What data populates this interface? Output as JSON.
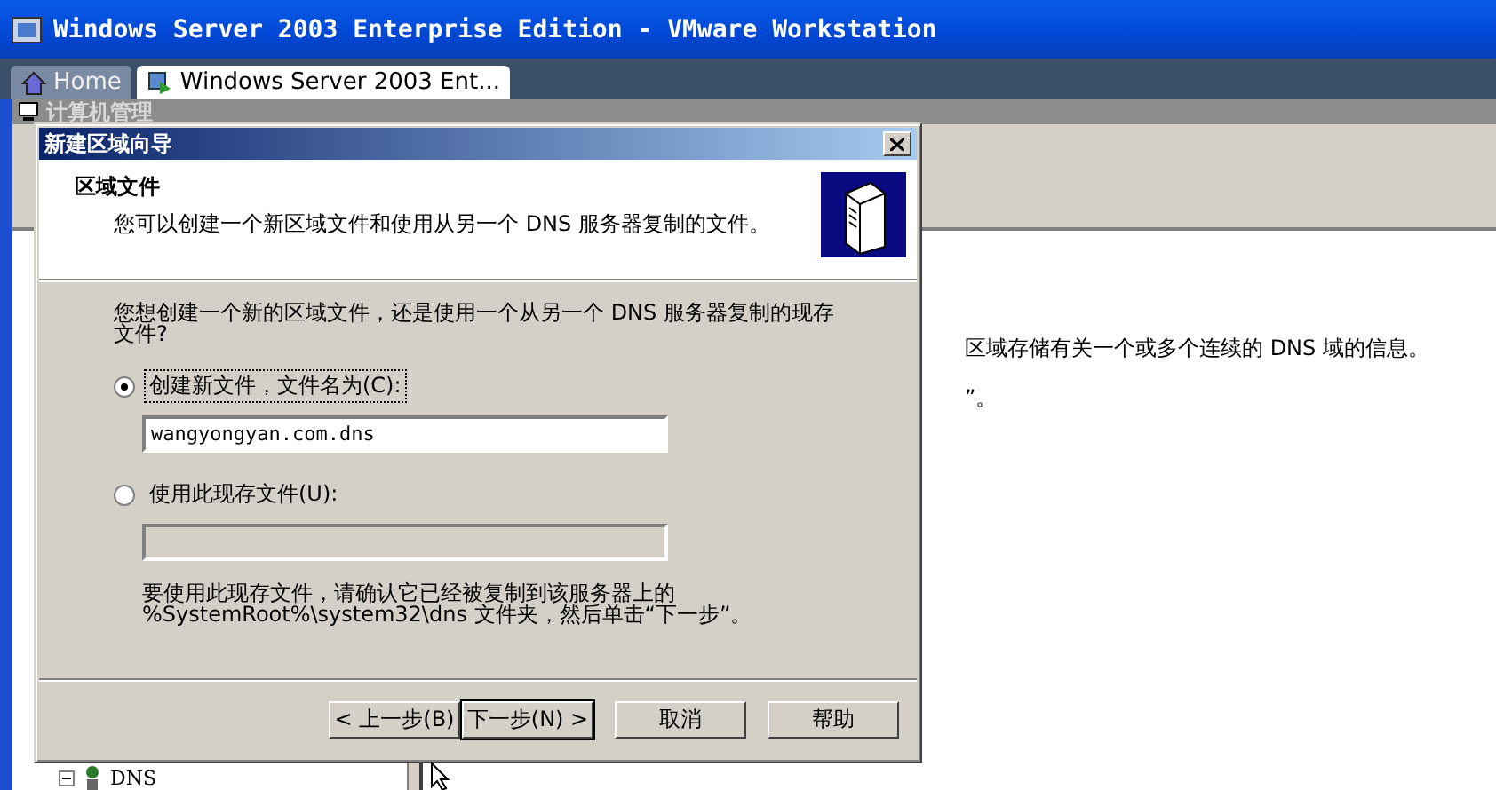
{
  "window": {
    "title": "Windows Server 2003 Enterprise Edition - VMware Workstation"
  },
  "tabs": [
    {
      "label": "Home",
      "selected": false
    },
    {
      "label": "Windows Server 2003 Ent...",
      "selected": true
    }
  ],
  "console": {
    "title": "计算机管理",
    "tree": [
      {
        "label": "DNS"
      }
    ],
    "details": [
      "区域存储有关一个或多个连续的 DNS 域的信息。",
      "”。"
    ]
  },
  "dialog": {
    "title": "新建区域向导",
    "heading": "区域文件",
    "subtitle": "您可以创建一个新区域文件和使用从另一个 DNS 服务器复制的文件。",
    "question": "您想创建一个新的区域文件，还是使用一个从另一个 DNS 服务器复制的现存文件?",
    "options": [
      {
        "label": "创建新文件，文件名为(C):",
        "selected": true,
        "value": "wangyongyan.com.dns",
        "disabled": false
      },
      {
        "label": "使用此现存文件(U):",
        "selected": false,
        "disabled": true
      }
    ],
    "note": "要使用此现存文件，请确认它已经被复制到该服务器上的\n%SystemRoot%\\system32\\dns 文件夹，然后单击“下一步”。",
    "buttons": [
      {
        "label": "< 上一步(B)",
        "default": false
      },
      {
        "label": "下一步(N) >",
        "default": true
      },
      {
        "label": "取消",
        "default": false
      },
      {
        "label": "帮助",
        "default": false
      }
    ]
  }
}
